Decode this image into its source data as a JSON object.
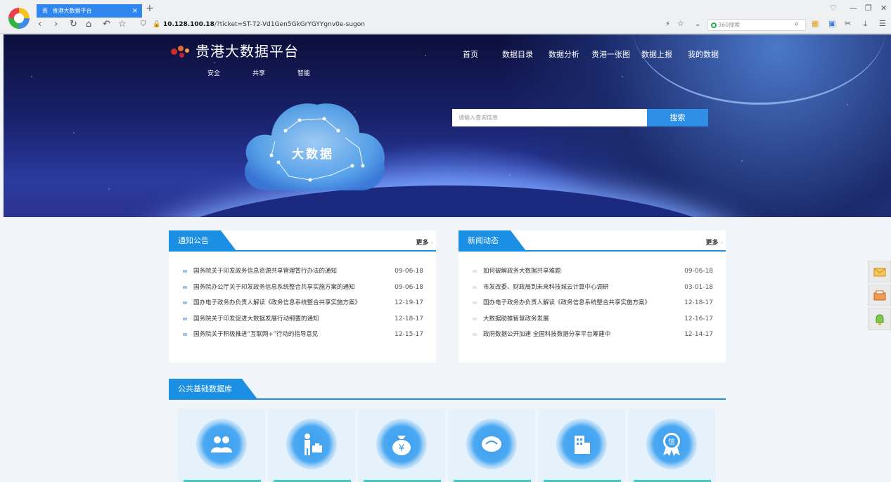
{
  "browser": {
    "tab_icon_glyph": "贵",
    "tab_title": "贵港大数据平台",
    "tab_close": "×",
    "new_tab": "+",
    "url_host": "10.128.100.18",
    "url_path": "/?ticket=ST-72-Vd1Gen5GkGrYGYYgnv0e-sugon",
    "search_placeholder": "360搜索"
  },
  "site": {
    "title": "贵港大数据平台",
    "taglines": [
      "安全",
      "共享",
      "智能"
    ],
    "nav": [
      "首页",
      "数据目录",
      "数据分析",
      "贵港一张图",
      "数据上报",
      "我的数据"
    ],
    "search_placeholder": "请输入查询信息",
    "search_button": "搜索",
    "hero_text": "大数据"
  },
  "notices": {
    "title": "通知公告",
    "more": "更多",
    "items": [
      {
        "text": "国务院关于印发政务信息资源共享管理暂行办法的通知",
        "date": "09-06-18"
      },
      {
        "text": "国务院办公厅关于印发政务信息系统整合共享实施方案的通知",
        "date": "09-06-18"
      },
      {
        "text": "国办电子政务办负责人解读《政务信息系统整合共享实施方案》",
        "date": "12-19-17"
      },
      {
        "text": "国务院关于印发促进大数据发展行动纲要的通知",
        "date": "12-18-17"
      },
      {
        "text": "国务院关于积极推进“互联网+”行动的指导意见",
        "date": "12-15-17"
      }
    ]
  },
  "news": {
    "title": "新闻动态",
    "more": "更多",
    "items": [
      {
        "text": "如何破解政务大数据共享难题",
        "date": "09-06-18"
      },
      {
        "text": "市发改委、财政局到未来科技城云计算中心调研",
        "date": "03-01-18"
      },
      {
        "text": "国办电子政务办负责人解读《政务信息系统整合共享实施方案》",
        "date": "12-18-17"
      },
      {
        "text": "大数据助推智慧政务发展",
        "date": "12-16-17"
      },
      {
        "text": "政府数据公开加速 全国科技数据分享平台筹建中",
        "date": "12-14-17"
      }
    ]
  },
  "public_db": {
    "title": "公共基础数据库",
    "cards": [
      "people-icon",
      "worker-icon",
      "money-bag-icon",
      "lemon-icon",
      "building-icon",
      "credit-badge-icon"
    ],
    "credit_glyph": "信",
    "money_glyph": "¥"
  },
  "colors": {
    "accent": "#1a8fe3",
    "tab_blue": "#2f86ef",
    "card_bar": "#44c9c0"
  }
}
